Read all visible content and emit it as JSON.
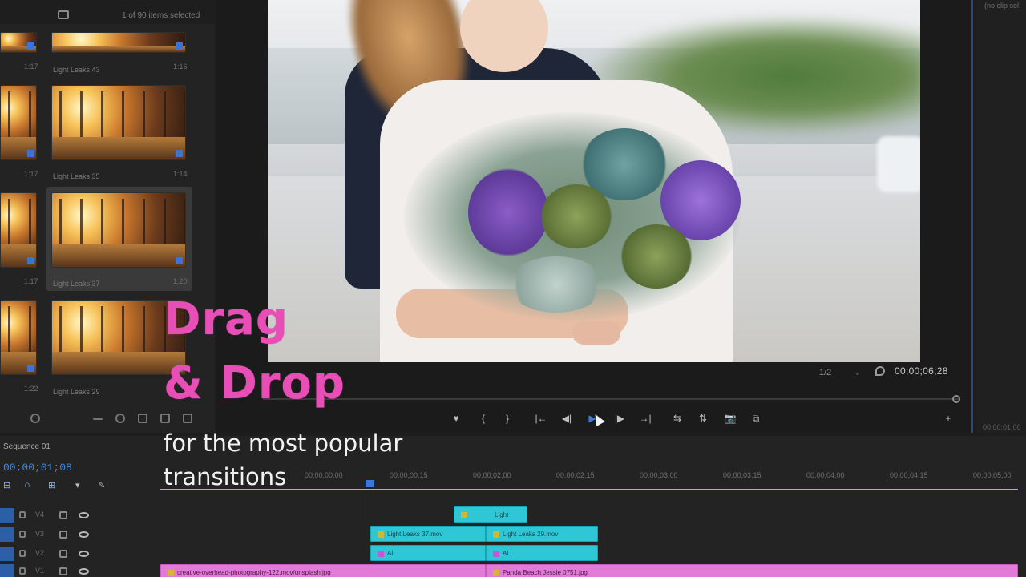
{
  "project": {
    "selection_count": "1 of 90 items selected",
    "clips": [
      {
        "label": "Light Leaks 43",
        "duration": "1:17",
        "right_duration": "1:16"
      },
      {
        "label": "Light Leaks 35",
        "duration": "1:17",
        "right_duration": "1:14"
      },
      {
        "label": "Light Leaks 37",
        "duration": "1:17",
        "right_duration": "1:20"
      },
      {
        "label": "Light Leaks 29",
        "duration": "1:22",
        "right_duration": ""
      }
    ]
  },
  "monitor": {
    "fit": "1/2",
    "duration_timecode": "00;00;06;28",
    "controls": [
      "♥",
      "{",
      "}",
      "|←",
      "◀|",
      "▶",
      "|▶",
      "→|",
      "⇆",
      "⇅",
      "📷",
      "⧉",
      "+"
    ]
  },
  "right_panel": {
    "top_text": "(no clip sel",
    "bottom_text": "00;00;01;00"
  },
  "timeline": {
    "sequence_name": "Sequence 01",
    "current_timecode": "00;00;01;08",
    "ruler_ticks": [
      "00;00;00;00",
      "00;00;00;15",
      "00;00;02;00",
      "00;00;02;15",
      "00;00;03;00",
      "00;00;03;15",
      "00;00;04;00",
      "00;00;04;15",
      "00;00;05;00"
    ],
    "tracks": [
      {
        "name": "V4"
      },
      {
        "name": "V3"
      },
      {
        "name": "V2"
      },
      {
        "name": "V1"
      }
    ],
    "clips": {
      "v4_a": "Light",
      "v3_a": "Light Leaks 37.mov",
      "v3_b": "Light Leaks 29.mov",
      "v2_a": "Al",
      "v2_b": "Al",
      "v1_a": "creative-overhead-photography-122.mov/unsplash.jpg",
      "v1_b": "Panda Beach Jessie 0751.jpg"
    }
  },
  "overlay": {
    "headline_1": "Drag",
    "headline_2": "& Drop",
    "subline_1": "for the most popular",
    "subline_2": "transitions"
  },
  "colors": {
    "accent_blue": "#3a78d8",
    "headline_pink": "#e84fb6",
    "clip_cyan": "#2fc7d6",
    "clip_pink": "#e27ad8",
    "work_area_yellow": "#b9c23a"
  }
}
